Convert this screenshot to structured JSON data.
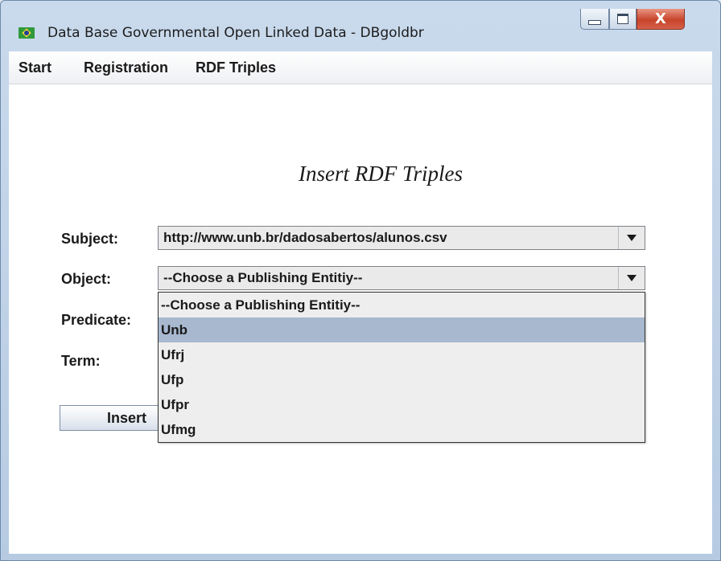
{
  "window": {
    "title": "Data Base Governmental Open Linked Data - DBgoldbr",
    "icon": "brazil-flag-icon",
    "controls": {
      "minimize_icon": "minimize-icon",
      "maximize_icon": "maximize-icon",
      "close_label": "X"
    }
  },
  "menu": {
    "items": [
      {
        "label": "Start"
      },
      {
        "label": "Registration"
      },
      {
        "label": "RDF Triples"
      }
    ]
  },
  "form": {
    "heading": "Insert RDF Triples",
    "subject_label": "Subject:",
    "subject_value": "http://www.unb.br/dadosabertos/alunos.csv",
    "object_label": "Object:",
    "object_value": "--Choose a Publishing Entitiy--",
    "predicate_label": "Predicate:",
    "term_label": "Term:",
    "insert_label": "Insert"
  },
  "dropdown": {
    "options": [
      {
        "label": "--Choose a Publishing Entitiy--"
      },
      {
        "label": "Unb"
      },
      {
        "label": "Ufrj"
      },
      {
        "label": "Ufp"
      },
      {
        "label": "Ufpr"
      },
      {
        "label": "Ufmg"
      }
    ],
    "highlighted": "Unb"
  },
  "colors": {
    "highlight": "#a7b8cf",
    "close_button": "#c7442a"
  }
}
